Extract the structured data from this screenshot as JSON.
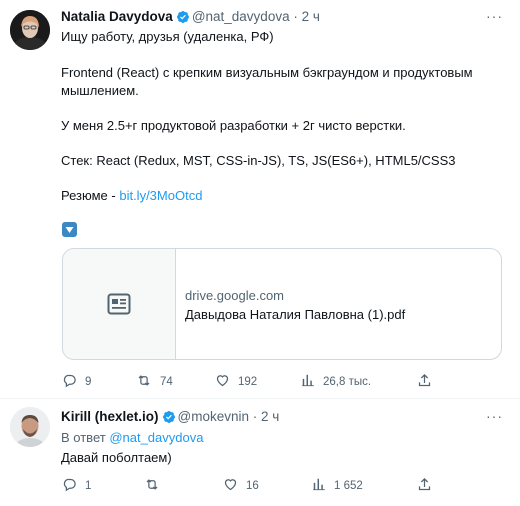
{
  "tweets": [
    {
      "name": "Natalia Davydova",
      "handle": "@nat_davydova",
      "dot": "·",
      "time": "2 ч",
      "more": "···",
      "lines": [
        "Ищу работу, друзья (удаленка, РФ)",
        "Frontend (React) с крепким визуальным бэкграундом и продуктовым",
        "мышлением.",
        "У меня 2.5+г продуктовой разработки + 2г чисто верстки.",
        "Стек: React (Redux, MST, CSS-in-JS), TS,  JS(ES6+), HTML5/CSS3"
      ],
      "resume_label": "Резюме - ",
      "resume_link": "bit.ly/3MoOtcd",
      "emoji": "down-arrow-button",
      "card": {
        "domain": "drive.google.com",
        "title": "Давыдова Наталия Павловна (1).pdf"
      },
      "stats": {
        "replies": "9",
        "retweets": "74",
        "likes": "192",
        "views": "26,8 тыс."
      }
    },
    {
      "name": "Kirill (hexlet.io)",
      "handle": "@mokevnin",
      "dot": "·",
      "time": "2 ч",
      "more": "···",
      "reply_prefix": "В ответ ",
      "reply_to": "@nat_davydova",
      "text": "Давай поболтаем)",
      "stats": {
        "replies": "1",
        "retweets": "",
        "likes": "16",
        "views": "1 652"
      }
    }
  ],
  "icons": {
    "verified": "verified-badge-icon",
    "reply": "reply-icon",
    "retweet": "retweet-icon",
    "like": "heart-icon",
    "views": "views-icon",
    "share": "share-icon",
    "card": "document-card-icon"
  },
  "colors": {
    "accent": "#1d9bf0",
    "secondary_text": "#536471",
    "border": "#cfd9de"
  }
}
